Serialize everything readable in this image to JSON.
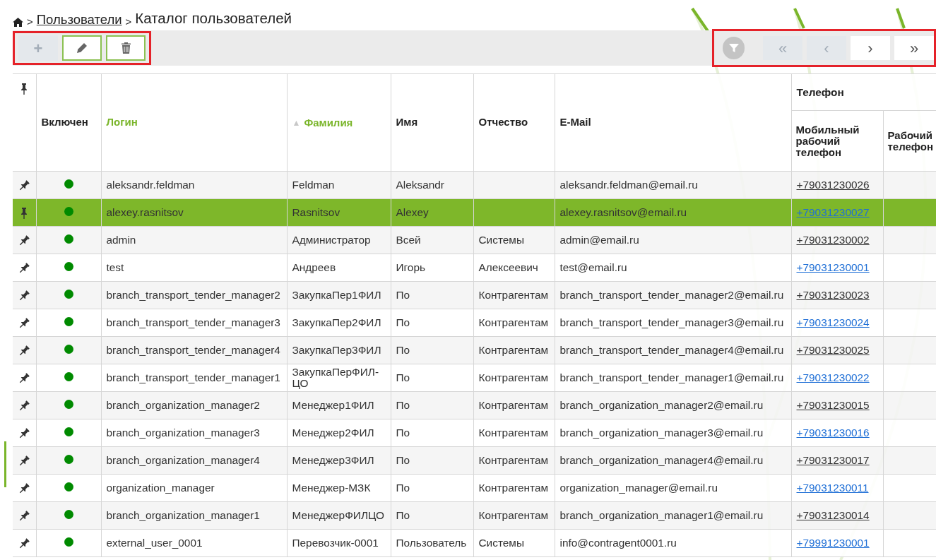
{
  "breadcrumb": {
    "separator": ">",
    "link": "Пользователи",
    "current": "Каталог пользователей"
  },
  "toolbar": {
    "buttons": [
      {
        "kind": "add",
        "label": "+",
        "disabled": true
      },
      {
        "kind": "edit",
        "disabled": false
      },
      {
        "kind": "delete",
        "disabled": false
      }
    ]
  },
  "pager": {
    "buttons": [
      {
        "label": "«",
        "disabled": true
      },
      {
        "label": "‹",
        "disabled": true
      },
      {
        "label": "›",
        "disabled": false
      },
      {
        "label": "»",
        "disabled": false
      }
    ]
  },
  "table": {
    "columns": [
      {
        "label": "Включен",
        "sortable": false
      },
      {
        "label": "Логин",
        "sortable": true
      },
      {
        "label": "Фамилия",
        "sortable": true,
        "sort_indicator": "▲"
      },
      {
        "label": "Имя",
        "sortable": false
      },
      {
        "label": "Отчество",
        "sortable": false
      },
      {
        "label": "E-Mail",
        "sortable": false
      }
    ],
    "group_column": {
      "label": "Телефон",
      "children": [
        "Мобильный рабочий телефон",
        "Рабочий телефон"
      ]
    },
    "rows": [
      {
        "enabled": true,
        "pinned": false,
        "selected": false,
        "login": "aleksandr.feldman",
        "last_name": "Feldman",
        "first_name": "Aleksandr",
        "email": "aleksandr.feldman@email.ru",
        "mobile": "+79031230026"
      },
      {
        "enabled": true,
        "pinned": true,
        "selected": true,
        "login": "alexey.rasnitsov",
        "last_name": "Rasnitsov",
        "first_name": "Alexey",
        "email": "alexey.rasnitsov@email.ru",
        "mobile": "+79031230027"
      },
      {
        "enabled": true,
        "pinned": false,
        "selected": false,
        "login": "admin",
        "last_name": "Администратор",
        "first_name": "Всей",
        "patronymic": "Системы",
        "email": "admin@email.ru",
        "mobile": "+79031230002"
      },
      {
        "enabled": true,
        "pinned": false,
        "selected": false,
        "login": "test",
        "last_name": "Андреев",
        "first_name": "Игорь",
        "patronymic": "Алексеевич",
        "email": "test@email.ru",
        "mobile": "+79031230001"
      },
      {
        "enabled": true,
        "pinned": false,
        "selected": false,
        "login": "branch_transport_tender_manager2",
        "last_name": "ЗакупкаПер1ФИЛ",
        "first_name": "По",
        "patronymic": "Контрагентам",
        "email": "branch_transport_tender_manager2@email.ru",
        "mobile": "+79031230023"
      },
      {
        "enabled": true,
        "pinned": false,
        "selected": false,
        "login": "branch_transport_tender_manager3",
        "last_name": "ЗакупкаПер2ФИЛ",
        "first_name": "По",
        "patronymic": "Контрагентам",
        "email": "branch_transport_tender_manager3@email.ru",
        "mobile": "+79031230024"
      },
      {
        "enabled": true,
        "pinned": false,
        "selected": false,
        "login": "branch_transport_tender_manager4",
        "last_name": "ЗакупкаПер3ФИЛ",
        "first_name": "По",
        "patronymic": "Контрагентам",
        "email": "branch_transport_tender_manager4@email.ru",
        "mobile": "+79031230025"
      },
      {
        "enabled": true,
        "pinned": false,
        "selected": false,
        "login": "branch_transport_tender_manager1",
        "last_name": "ЗакупкаПерФИЛ-ЦО",
        "first_name": "По",
        "patronymic": "Контрагентам",
        "email": "branch_transport_tender_manager1@email.ru",
        "mobile": "+79031230022"
      },
      {
        "enabled": true,
        "pinned": false,
        "selected": false,
        "login": "branch_organization_manager2",
        "last_name": "Менеджер1ФИЛ",
        "first_name": "По",
        "patronymic": "Контрагентам",
        "email": "branch_organization_manager2@email.ru",
        "mobile": "+79031230015"
      },
      {
        "enabled": true,
        "pinned": false,
        "selected": false,
        "login": "branch_organization_manager3",
        "last_name": "Менеджер2ФИЛ",
        "first_name": "По",
        "patronymic": "Контрагентам",
        "email": "branch_organization_manager3@email.ru",
        "mobile": "+79031230016"
      },
      {
        "enabled": true,
        "pinned": false,
        "selected": false,
        "login": "branch_organization_manager4",
        "last_name": "Менеджер3ФИЛ",
        "first_name": "По",
        "patronymic": "Контрагентам",
        "email": "branch_organization_manager4@email.ru",
        "mobile": "+79031230017"
      },
      {
        "enabled": true,
        "pinned": false,
        "selected": false,
        "login": "organization_manager",
        "last_name": "Менеджер-МЗК",
        "first_name": "По",
        "patronymic": "Контрагентам",
        "email": "organization_manager@email.ru",
        "mobile": "+79031230011"
      },
      {
        "enabled": true,
        "pinned": false,
        "selected": false,
        "login": "branch_organization_manager1",
        "last_name": "МенеджерФИЛЦО",
        "first_name": "По",
        "patronymic": "Контрагентам",
        "email": "branch_organization_manager1@email.ru",
        "mobile": "+79031230014"
      },
      {
        "enabled": true,
        "pinned": false,
        "selected": false,
        "login": "external_user_0001",
        "last_name": "Перевозчик-0001",
        "first_name": "Пользователь",
        "patronymic": "Системы",
        "email": "info@contragent0001.ru",
        "mobile": "+79991230001"
      }
    ]
  }
}
